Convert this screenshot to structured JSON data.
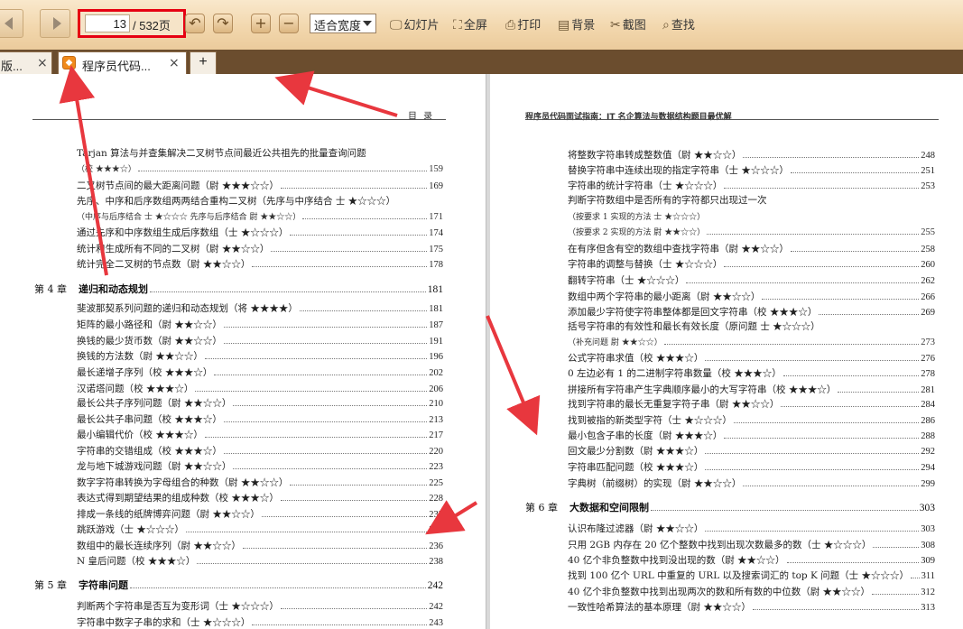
{
  "toolbar": {
    "page_current": "13",
    "page_total": "/ 532页",
    "zoom_select": "适合宽度",
    "tools": [
      {
        "icon": "slideshow-icon",
        "glyph": "🖵",
        "label": "幻灯片"
      },
      {
        "icon": "fullscreen-icon",
        "glyph": "⛶",
        "label": "全屏"
      },
      {
        "icon": "print-icon",
        "glyph": "⎙",
        "label": "打印"
      },
      {
        "icon": "background-icon",
        "glyph": "▤",
        "label": "背景"
      },
      {
        "icon": "scissors-icon",
        "glyph": "✂",
        "label": "截图"
      },
      {
        "icon": "search-icon",
        "glyph": "⌕",
        "label": "查找"
      }
    ],
    "zoom_in": "+",
    "zoom_out": "−"
  },
  "tabs": [
    {
      "label": "版...",
      "close": "×"
    },
    {
      "label": "程序员代码...",
      "close": "×"
    }
  ],
  "new_tab": "+",
  "accent_color": "#e60012",
  "left_page": {
    "header": "目    录",
    "rows": [
      {
        "text": "Tarjan 算法与并查集解决二叉树节点间最近公共祖先的批量查询问题",
        "page": "",
        "kind": "nodots"
      },
      {
        "text": "（校 ★★★☆）",
        "page": "159",
        "kind": "sub"
      },
      {
        "text": "二叉树节点间的最大距离问题（尉 ★★★☆☆）",
        "page": "169",
        "kind": "item"
      },
      {
        "text": "先序、中序和后序数组两两结合重构二叉树（先序与中序结合  士 ★☆☆☆）",
        "page": "",
        "kind": "nodots"
      },
      {
        "text": "（中序与后序结合  士 ★☆☆☆   先序与后序结合  尉 ★★☆☆）",
        "page": "171",
        "kind": "sub"
      },
      {
        "text": "通过先序和中序数组生成后序数组（士 ★☆☆☆）",
        "page": "174",
        "kind": "item"
      },
      {
        "text": "统计和生成所有不同的二叉树（尉 ★★☆☆）",
        "page": "175",
        "kind": "item"
      },
      {
        "text": "统计完全二叉树的节点数（尉 ★★☆☆）",
        "page": "178",
        "kind": "item"
      },
      {
        "chapter": "第 4 章",
        "text": "递归和动态规划",
        "page": "181",
        "kind": "chap"
      },
      {
        "text": "斐波那契系列问题的递归和动态规划（将 ★★★★）",
        "page": "181",
        "kind": "item"
      },
      {
        "text": "矩阵的最小路径和（尉 ★★☆☆）",
        "page": "187",
        "kind": "item"
      },
      {
        "text": "换钱的最少货币数（尉 ★★☆☆）",
        "page": "191",
        "kind": "item"
      },
      {
        "text": "换钱的方法数（尉 ★★☆☆）",
        "page": "196",
        "kind": "item"
      },
      {
        "text": "最长递增子序列（校 ★★★☆）",
        "page": "202",
        "kind": "item"
      },
      {
        "text": "汉诺塔问题（校 ★★★☆）",
        "page": "206",
        "kind": "item"
      },
      {
        "text": "最长公共子序列问题（尉 ★★☆☆）",
        "page": "210",
        "kind": "item"
      },
      {
        "text": "最长公共子串问题（校 ★★★☆）",
        "page": "213",
        "kind": "item"
      },
      {
        "text": "最小编辑代价（校 ★★★☆）",
        "page": "217",
        "kind": "item"
      },
      {
        "text": "字符串的交错组成（校 ★★★☆）",
        "page": "220",
        "kind": "item"
      },
      {
        "text": "龙与地下城游戏问题（尉 ★★☆☆）",
        "page": "223",
        "kind": "item"
      },
      {
        "text": "数字字符串转换为字母组合的种数（尉 ★★☆☆）",
        "page": "225",
        "kind": "item"
      },
      {
        "text": "表达式得到期望结果的组成种数（校 ★★★☆）",
        "page": "228",
        "kind": "item"
      },
      {
        "text": "排成一条线的纸牌博弈问题（尉 ★★☆☆）",
        "page": "233",
        "kind": "item"
      },
      {
        "text": "跳跃游戏（士 ★☆☆☆）",
        "page": "235",
        "kind": "item"
      },
      {
        "text": "数组中的最长连续序列（尉 ★★☆☆）",
        "page": "236",
        "kind": "item"
      },
      {
        "text": "N 皇后问题（校 ★★★☆）",
        "page": "238",
        "kind": "item"
      },
      {
        "chapter": "第 5 章",
        "text": "字符串问题",
        "page": "242",
        "kind": "chap"
      },
      {
        "text": "判断两个字符串是否互为变形词（士 ★☆☆☆）",
        "page": "242",
        "kind": "item"
      },
      {
        "text": "字符串中数字子串的求和（士 ★☆☆☆）",
        "page": "243",
        "kind": "item"
      }
    ]
  },
  "right_page": {
    "header": "程序员代码面试指南：IT 名企算法与数据结构题目最优解",
    "rows": [
      {
        "text": "将整数字符串转成整数值（尉 ★★☆☆）",
        "page": "248",
        "kind": "item"
      },
      {
        "text": "替换字符串中连续出现的指定字符串（士 ★☆☆☆）",
        "page": "251",
        "kind": "item"
      },
      {
        "text": "字符串的统计字符串（士 ★☆☆☆）",
        "page": "253",
        "kind": "item"
      },
      {
        "text": "判断字符数组中是否所有的字符都只出现过一次",
        "page": "",
        "kind": "nodots"
      },
      {
        "text": "（按要求 1 实现的方法  士 ★☆☆☆）",
        "page": "",
        "kind": "sub-nodots"
      },
      {
        "text": "（按要求 2 实现的方法  尉 ★★☆☆）",
        "page": "255",
        "kind": "sub"
      },
      {
        "text": "在有序但含有空的数组中查找字符串（尉 ★★☆☆）",
        "page": "258",
        "kind": "item"
      },
      {
        "text": "字符串的调整与替换（士 ★☆☆☆）",
        "page": "260",
        "kind": "item"
      },
      {
        "text": "翻转字符串（士 ★☆☆☆）",
        "page": "262",
        "kind": "item"
      },
      {
        "text": "数组中两个字符串的最小距离（尉 ★★☆☆）",
        "page": "266",
        "kind": "item"
      },
      {
        "text": "添加最少字符使字符串整体都是回文字符串（校 ★★★☆）",
        "page": "269",
        "kind": "item"
      },
      {
        "text": "括号字符串的有效性和最长有效长度（原问题  士 ★☆☆☆）",
        "page": "",
        "kind": "nodots"
      },
      {
        "text": "（补充问题  尉 ★★☆☆）",
        "page": "273",
        "kind": "sub"
      },
      {
        "text": "公式字符串求值（校 ★★★☆）",
        "page": "276",
        "kind": "item"
      },
      {
        "text": "0 左边必有 1 的二进制字符串数量（校 ★★★☆）",
        "page": "278",
        "kind": "item"
      },
      {
        "text": "拼接所有字符串产生字典顺序最小的大写字符串（校 ★★★☆）",
        "page": "281",
        "kind": "item"
      },
      {
        "text": "找到字符串的最长无重复字符子串（尉 ★★☆☆）",
        "page": "284",
        "kind": "item"
      },
      {
        "text": "找到被指的新类型字符（士 ★☆☆☆）",
        "page": "286",
        "kind": "item"
      },
      {
        "text": "最小包含子串的长度（尉 ★★★☆）",
        "page": "288",
        "kind": "item"
      },
      {
        "text": "回文最少分割数（尉 ★★★☆）",
        "page": "292",
        "kind": "item"
      },
      {
        "text": "字符串匹配问题（校 ★★★☆）",
        "page": "294",
        "kind": "item"
      },
      {
        "text": "字典树（前缀树）的实现（尉 ★★☆☆）",
        "page": "299",
        "kind": "item"
      },
      {
        "chapter": "第 6 章",
        "text": "大数据和空间限制",
        "page": "303",
        "kind": "chap"
      },
      {
        "text": "认识布隆过滤器（尉 ★★☆☆）",
        "page": "303",
        "kind": "item"
      },
      {
        "text": "只用 2GB 内存在 20 亿个整数中找到出现次数最多的数（士 ★☆☆☆）",
        "page": "308",
        "kind": "item"
      },
      {
        "text": "40 亿个非负整数中找到没出现的数（尉 ★★☆☆）",
        "page": "309",
        "kind": "item"
      },
      {
        "text": "找到 100 亿个 URL 中重复的 URL 以及搜索词汇的 top K 问题（士 ★☆☆☆）",
        "page": "311",
        "kind": "item"
      },
      {
        "text": "40 亿个非负整数中找到出现两次的数和所有数的中位数（尉 ★★☆☆）",
        "page": "312",
        "kind": "item"
      },
      {
        "text": "一致性哈希算法的基本原理（尉 ★★☆☆）",
        "page": "313",
        "kind": "item"
      }
    ]
  }
}
